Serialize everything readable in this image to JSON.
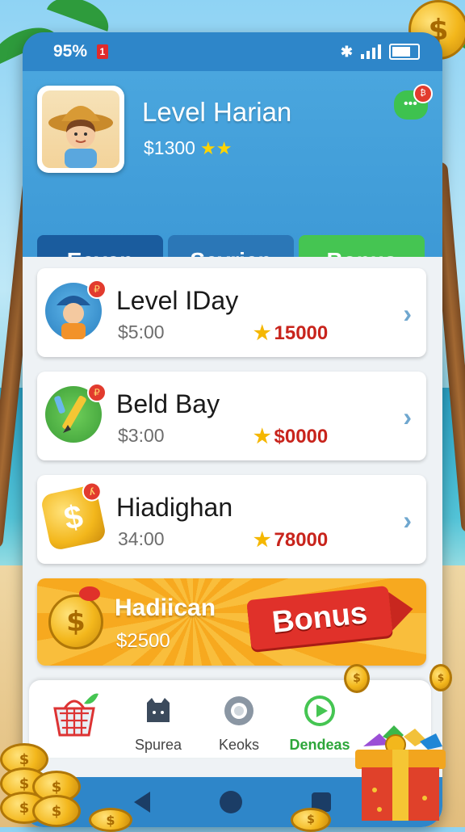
{
  "status_bar": {
    "battery_percent": "95%",
    "battery_badge": "1"
  },
  "header": {
    "title": "Level Harian",
    "balance": "$1300",
    "stars": "★★"
  },
  "tabs": [
    {
      "label": "Eevan"
    },
    {
      "label": "Seyriep"
    },
    {
      "label": "Bonus"
    }
  ],
  "cards": [
    {
      "title": "Level IDay",
      "time": "$5:00",
      "reward": "15000",
      "icon": "explorer-avatar-icon"
    },
    {
      "title": "Beld Bay",
      "time": "$3:00",
      "reward": "$0000",
      "icon": "pencil-icon"
    },
    {
      "title": "Hiadighan",
      "time": "34:00",
      "reward": "78000",
      "icon": "dollar-coin-icon"
    }
  ],
  "bonus_card": {
    "title": "Hadiican",
    "amount": "$2500",
    "ribbon": "Bonus"
  },
  "bottom_nav": [
    {
      "label": "",
      "icon": "shopping-basket-icon"
    },
    {
      "label": "Spurea",
      "icon": "castle-icon"
    },
    {
      "label": "Keoks",
      "icon": "ring-icon"
    },
    {
      "label": "Dendeas",
      "icon": "play-icon",
      "active": true
    }
  ],
  "colors": {
    "accent_blue": "#2e86c9",
    "tab_active": "#1a5c9e",
    "bonus_green": "#45c552",
    "reward_red": "#c8241c"
  }
}
